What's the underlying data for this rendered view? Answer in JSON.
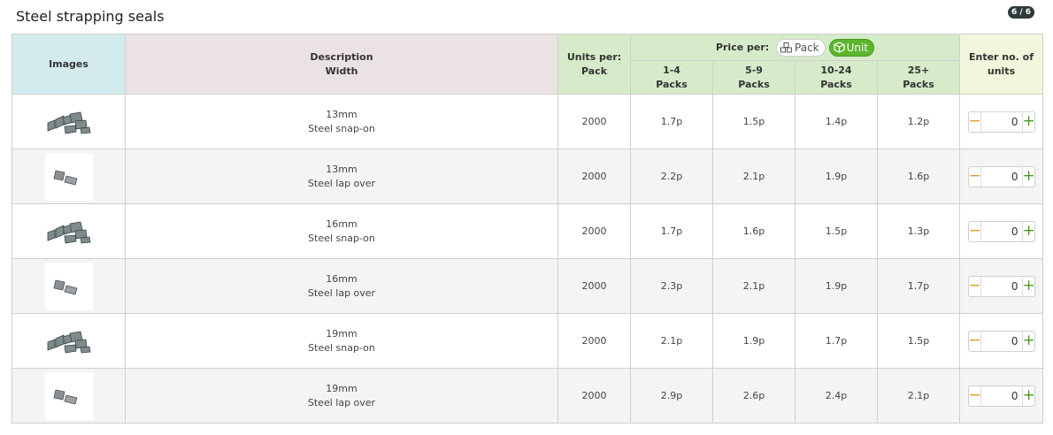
{
  "page": {
    "title": "Steel strapping seals",
    "page_badge": "6 / 6"
  },
  "table": {
    "headers": {
      "images": "Images",
      "description": "Description",
      "width": "Width",
      "units_per": "Units per:",
      "pack": "Pack",
      "price_per": "Price per:",
      "toggle_pack": "Pack",
      "toggle_unit": "Unit",
      "enter_units": "Enter no. of units"
    },
    "tiers": [
      {
        "range": "1-4",
        "label": "Packs"
      },
      {
        "range": "5-9",
        "label": "Packs"
      },
      {
        "range": "10-24",
        "label": "Packs"
      },
      {
        "range": "25+",
        "label": "Packs"
      }
    ],
    "rows": [
      {
        "width": "13mm",
        "description": "Steel snap-on",
        "image": "snap-on-seal",
        "units": "2000",
        "prices": [
          "1.7p",
          "1.5p",
          "1.4p",
          "1.2p"
        ],
        "qty": "0"
      },
      {
        "width": "13mm",
        "description": "Steel lap over",
        "image": "lap-over-seal",
        "units": "2000",
        "prices": [
          "2.2p",
          "2.1p",
          "1.9p",
          "1.6p"
        ],
        "qty": "0"
      },
      {
        "width": "16mm",
        "description": "Steel snap-on",
        "image": "snap-on-seal",
        "units": "2000",
        "prices": [
          "1.7p",
          "1.6p",
          "1.5p",
          "1.3p"
        ],
        "qty": "0"
      },
      {
        "width": "16mm",
        "description": "Steel lap over",
        "image": "lap-over-seal",
        "units": "2000",
        "prices": [
          "2.3p",
          "2.1p",
          "1.9p",
          "1.7p"
        ],
        "qty": "0"
      },
      {
        "width": "19mm",
        "description": "Steel snap-on",
        "image": "snap-on-seal",
        "units": "2000",
        "prices": [
          "2.1p",
          "1.9p",
          "1.7p",
          "1.5p"
        ],
        "qty": "0"
      },
      {
        "width": "19mm",
        "description": "Steel lap over",
        "image": "lap-over-seal",
        "units": "2000",
        "prices": [
          "2.9p",
          "2.6p",
          "2.4p",
          "2.1p"
        ],
        "qty": "0"
      }
    ],
    "stepper": {
      "minus": "−",
      "plus": "+"
    }
  },
  "colors": {
    "accent_green": "#5cb52e",
    "minus_orange": "#e09a2c"
  }
}
